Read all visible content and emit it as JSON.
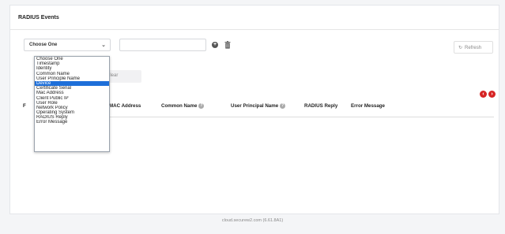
{
  "card": {
    "title": "RADIUS Events"
  },
  "filter": {
    "select_value": "Choose One",
    "search_value": "",
    "refresh_label": "Refresh",
    "clear_label": "Clear",
    "options": [
      "Choose One",
      "Timestamp",
      "Identity",
      "Common Name",
      "User Principle Name",
      "Device",
      "Certificate Serial",
      "Mac Address",
      "Client Public IP",
      "User Role",
      "Network Policy",
      "Operating System",
      "RADIUS Reply",
      "Error Message"
    ],
    "highlighted_option": "Device"
  },
  "table": {
    "partial_col": "F",
    "columns": [
      "MAC Address",
      "Common Name",
      "User Principal Name",
      "RADIUS Reply",
      "Error Message"
    ]
  },
  "footer": {
    "text": "cloud.securew2.com (6.61.8A1)"
  },
  "icons": {
    "add": "plus-circle-icon",
    "trash": "trash-icon",
    "refresh": "refresh-icon",
    "chevron": "chevron-down-icon",
    "prev": "chevron-left-icon",
    "next": "chevron-right-icon",
    "help": "help-icon"
  },
  "colors": {
    "accent_red": "#d62424",
    "selection_blue": "#1e6fd9"
  }
}
